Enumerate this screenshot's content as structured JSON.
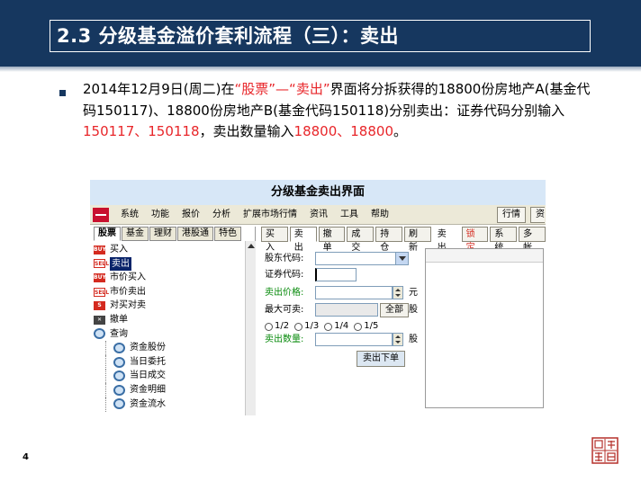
{
  "slide": {
    "title": "2.3 分级基金溢价套利流程（三）：卖出",
    "page_number": "4",
    "paragraph": {
      "seg1": "2014年12月9日(周二)在",
      "seg2": "“股票”—“卖出”",
      "seg3": "界面将分拆获得的18800份房地产A(基金代码150117)、18800份房地产B(基金代码150118)分别卖出：证券代码分别输入",
      "seg4": "150117、150118",
      "seg5": "，卖出数量输入",
      "seg6": "18800、18800",
      "seg7": "。"
    }
  },
  "screenshot": {
    "caption": "分级基金卖出界面",
    "menus": [
      "系统",
      "功能",
      "报价",
      "分析",
      "扩展市场行情",
      "资讯",
      "工具",
      "帮助"
    ],
    "menu_right": {
      "quotes": "行情",
      "cut": "资"
    },
    "left_tabs": [
      "股票",
      "基金",
      "理财",
      "港股通",
      "特色"
    ],
    "tree": [
      {
        "label": "买入",
        "icon": "buy-icon",
        "badge": "BUY"
      },
      {
        "label": "卖出",
        "icon": "sell-icon",
        "badge": "SELL"
      },
      {
        "label": "市价买入",
        "icon": "buy-icon",
        "badge": "BUY"
      },
      {
        "label": "市价卖出",
        "icon": "sell-icon",
        "badge": "SELL"
      },
      {
        "label": "对买对卖",
        "icon": "swap-icon",
        "badge": "S"
      },
      {
        "label": "撤单",
        "icon": "cancel-icon",
        "badge": "✕"
      },
      {
        "label": "查询",
        "icon": "query-icon",
        "badge": ""
      },
      {
        "label": "资金股份",
        "icon": "query-icon",
        "badge": ""
      },
      {
        "label": "当日委托",
        "icon": "query-icon",
        "badge": ""
      },
      {
        "label": "当日成交",
        "icon": "query-icon",
        "badge": ""
      },
      {
        "label": "资金明细",
        "icon": "query-icon",
        "badge": ""
      },
      {
        "label": "资金流水",
        "icon": "query-icon",
        "badge": ""
      }
    ],
    "toolbar": [
      "买入",
      "卖出",
      "撤单",
      "成交",
      "持仓",
      "刷新",
      "卖出",
      "锁定",
      "系统",
      "多帐"
    ],
    "form": {
      "account_label": "股东代码:",
      "code_label": "证券代码:",
      "price_label": "卖出价格:",
      "price_unit": "元",
      "max_label": "最大可卖:",
      "all_button": "全部",
      "max_unit": "股",
      "fractions": [
        "1/2",
        "1/3",
        "1/4",
        "1/5"
      ],
      "qty_label": "卖出数量:",
      "qty_unit": "股",
      "submit": "卖出下单"
    }
  }
}
